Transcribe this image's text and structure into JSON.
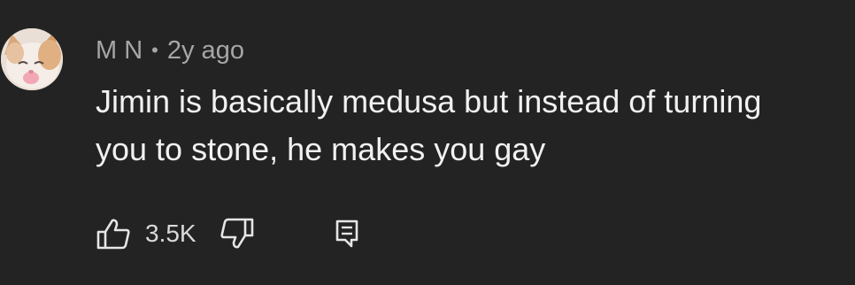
{
  "comment": {
    "author": "M N",
    "separator": "•",
    "age": "2y ago",
    "text": "Jimin is basically medusa but instead of turning you to stone, he makes you gay",
    "like_count": "3.5K"
  },
  "icons": {
    "avatar": "cat-avatar-icon",
    "like": "thumbs-up-icon",
    "dislike": "thumbs-down-icon",
    "reply": "comment-reply-icon"
  },
  "colors": {
    "background": "#232323",
    "primary_text": "#f1f1f1",
    "secondary_text": "#a6a6a6",
    "icon": "#e6e6e6"
  }
}
